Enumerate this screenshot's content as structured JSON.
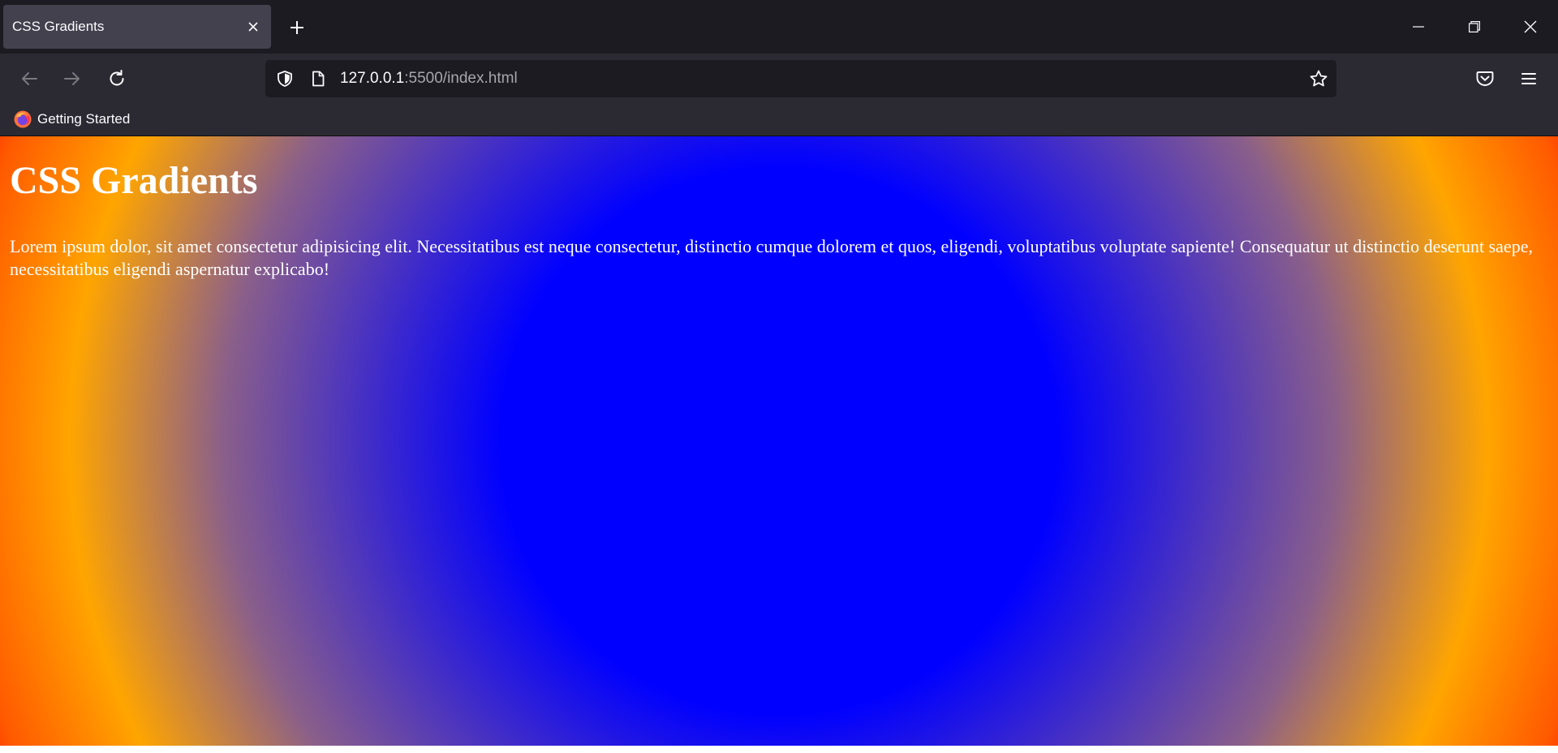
{
  "tab": {
    "title": "CSS Gradients",
    "close_icon": "close-icon"
  },
  "newtab_icon": "plus-icon",
  "window_controls": [
    "minimize-icon",
    "restore-icon",
    "close-icon"
  ],
  "nav": {
    "back_icon": "arrow-left-icon",
    "forward_icon": "arrow-right-icon",
    "reload_icon": "reload-icon"
  },
  "urlbar": {
    "host": "127.0.0.1",
    "rest": ":5500/index.html",
    "shield_icon": "shield-icon",
    "page_icon": "page-icon",
    "bookmark_icon": "star-icon"
  },
  "toolbar_right": [
    "pocket-icon",
    "hamburger-menu-icon"
  ],
  "bookmarks": [
    {
      "label": "Getting Started",
      "icon": "firefox-icon"
    }
  ],
  "page": {
    "heading": "CSS Gradients",
    "paragraph": "Lorem ipsum dolor, sit amet consectetur adipisicing elit. Necessitatibus est neque consectetur, distinctio cumque dolorem et quos, eligendi, voluptatibus voluptate sapiente! Consequatur ut distinctio deserunt saepe, necessitatibus eligendi aspernatur explicabo!",
    "gradient_colors": [
      "#0000ff",
      "#ffa500",
      "#ff0000"
    ]
  },
  "colors": {
    "tabstrip_bg": "#1c1b22",
    "toolbar_bg": "#2b2a33",
    "active_tab_bg": "#42414d",
    "urlbar_bg": "#1c1b22"
  }
}
